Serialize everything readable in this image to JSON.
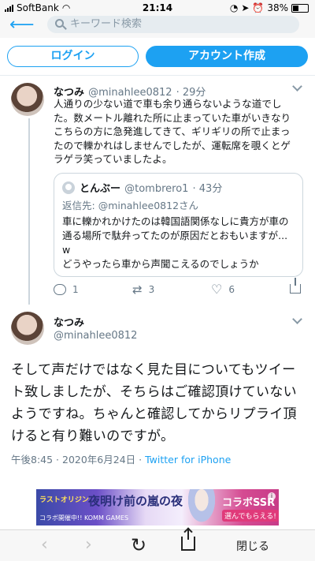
{
  "status_bar": {
    "carrier": "SoftBank",
    "time": "21:14",
    "battery": "38%"
  },
  "nav": {
    "search_placeholder": "キーワード検索"
  },
  "auth": {
    "login_label": "ログイン",
    "signup_label": "アカウント作成"
  },
  "tweet1": {
    "name": "なつみ",
    "handle": "@minahlee0812",
    "time": "· 29分",
    "text": "人通りの少ない道で車も余り通らないような道でした。数メートル離れた所に止まっていた車がいきなりこちらの方に急発進してきて、ギリギリの所で止まったので轢かれはしませんでしたが、運転席を覗くとゲラゲラ笑っていましたよ。",
    "quote": {
      "name": "とんぶー",
      "handle": "@tombrero1",
      "time": "· 43分",
      "reply_prefix": "返信先:",
      "reply_to": "@minahlee0812さん",
      "line1": "車に轢かれかけたのは韓国語関係なしに貴方が車の通る場所で駄弁ってたのが原因だとおもいますが...",
      "line2": "w",
      "line3": "どうやったら車から声聞こえるのでしょうか"
    },
    "actions": {
      "reply_count": "1",
      "retweet_count": "3",
      "like_count": "6"
    }
  },
  "tweet2": {
    "name": "なつみ",
    "handle": "@minahlee0812",
    "text": "そして声だけではなく見た目についてもツイート致しましたが、そちらはご確認頂けていないようですね。ちゃんと確認してからリプライ頂けると有り難いのですが。",
    "timestamp": "午後8:45 · 2020年6月24日 · ",
    "source": "Twitter for iPhone"
  },
  "ad": {
    "logo": "ラストオリジン",
    "title": "夜明け前の嵐の夜",
    "collab": "コラボSSR",
    "cta": "選んでもらえる!",
    "sub": "コラボ開催中!! KOMM GAMES"
  },
  "toolbar": {
    "close_label": "閉じる"
  },
  "colors": {
    "accent": "#1da1f2",
    "muted": "#657786",
    "border": "#e6ecf0"
  }
}
